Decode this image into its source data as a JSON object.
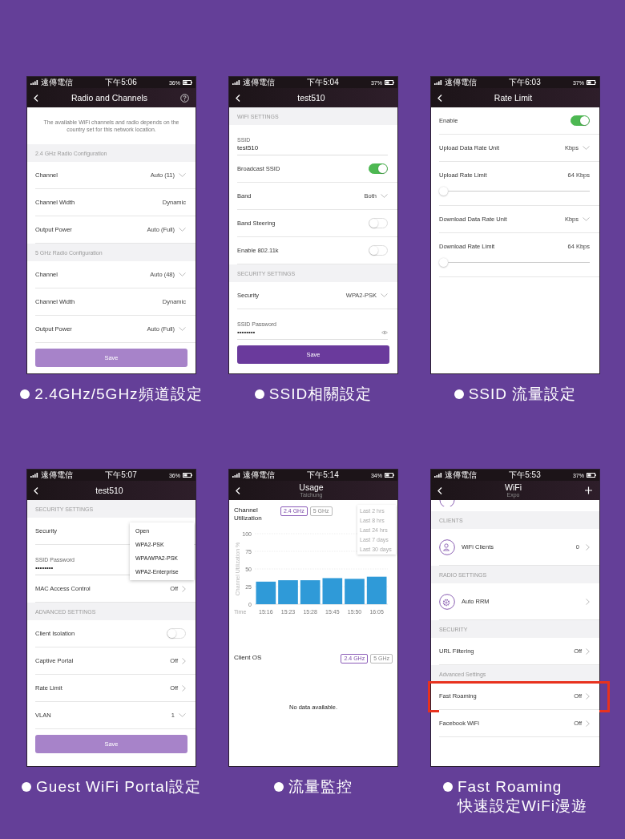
{
  "phones": [
    {
      "status": {
        "carrier": "遠傳電信",
        "time": "下午5:06",
        "battery": "36%"
      },
      "title": "Radio and Channels",
      "help": true,
      "items": [
        {
          "kind": "note",
          "text": "The available WiFi channels and radio depends on the country set for this network location."
        },
        {
          "kind": "section",
          "label": "2.4 GHz Radio Configuration"
        },
        {
          "kind": "select",
          "label": "Channel",
          "value": "Auto (11)"
        },
        {
          "kind": "row",
          "label": "Channel Width",
          "value": "Dynamic"
        },
        {
          "kind": "select",
          "label": "Output Power",
          "value": "Auto (Full)"
        },
        {
          "kind": "section",
          "label": "5 GHz Radio Configuration"
        },
        {
          "kind": "select",
          "label": "Channel",
          "value": "Auto (48)"
        },
        {
          "kind": "row",
          "label": "Channel Width",
          "value": "Dynamic"
        },
        {
          "kind": "select",
          "label": "Output Power",
          "value": "Auto (Full)"
        },
        {
          "kind": "button",
          "label": "Save",
          "disabled": true
        }
      ],
      "caption": [
        "2.4GHz/5GHz頻道設定"
      ]
    },
    {
      "status": {
        "carrier": "遠傳電信",
        "time": "下午5:04",
        "battery": "37%"
      },
      "title": "test510",
      "items": [
        {
          "kind": "section",
          "label": "WIFI SETTINGS"
        },
        {
          "kind": "field",
          "label": "SSID",
          "value": "test510"
        },
        {
          "kind": "toggle",
          "label": "Broadcast SSID",
          "on": true
        },
        {
          "kind": "select",
          "label": "Band",
          "value": "Both"
        },
        {
          "kind": "toggle",
          "label": "Band Steering",
          "on": false
        },
        {
          "kind": "toggle",
          "label": "Enable 802.11k",
          "on": false
        },
        {
          "kind": "section",
          "label": "SECURITY SETTINGS"
        },
        {
          "kind": "select",
          "label": "Security",
          "value": "WPA2-PSK"
        },
        {
          "kind": "field",
          "label": "SSID Password",
          "value": "••••••••",
          "reveal": true
        },
        {
          "kind": "button",
          "label": "Save",
          "disabled": false
        }
      ],
      "caption": [
        "SSID相關設定"
      ]
    },
    {
      "status": {
        "carrier": "遠傳電信",
        "time": "下午6:03",
        "battery": "37%"
      },
      "title": "Rate Limit",
      "items": [
        {
          "kind": "toggle",
          "label": "Enable",
          "on": true
        },
        {
          "kind": "select",
          "label": "Upload Data Rate Unit",
          "value": "Kbps"
        },
        {
          "kind": "slider",
          "label": "Upload Rate Limit",
          "reading": "64 Kbps",
          "level": 0
        },
        {
          "kind": "select",
          "label": "Download Data Rate Unit",
          "value": "Kbps"
        },
        {
          "kind": "slider",
          "label": "Download Rate Limit",
          "reading": "64 Kbps",
          "level": 0
        }
      ],
      "caption": [
        "SSID 流量設定"
      ]
    },
    {
      "status": {
        "carrier": "遠傳電信",
        "time": "下午5:07",
        "battery": "36%"
      },
      "title": "test510",
      "items": [
        {
          "kind": "section",
          "label": "SECURITY SETTINGS"
        },
        {
          "kind": "row",
          "label": "Security"
        },
        {
          "kind": "field",
          "label": "SSID Password",
          "value": "••••••••"
        },
        {
          "kind": "link",
          "label": "MAC Access Control",
          "value": "Off"
        },
        {
          "kind": "section",
          "label": "ADVANCED SETTINGS"
        },
        {
          "kind": "toggle",
          "label": "Client Isolation",
          "on": false
        },
        {
          "kind": "link",
          "label": "Captive Portal",
          "value": "Off"
        },
        {
          "kind": "link",
          "label": "Rate Limit",
          "value": "Off"
        },
        {
          "kind": "select",
          "label": "VLAN",
          "value": "1"
        },
        {
          "kind": "button",
          "label": "Save",
          "disabled": true
        }
      ],
      "dropdown": [
        "Open",
        "WPA2-PSK",
        "WPA/WPA2-PSK",
        "WPA2-Enterprise"
      ],
      "caption": [
        "Guest WiFi Portal設定"
      ]
    },
    {
      "status": {
        "carrier": "遠傳電信",
        "time": "下午5:14",
        "battery": "34%"
      },
      "title": "Usage",
      "subtitle": "Taichung",
      "usage": {
        "chart_title": "Channel Utilization",
        "bands": [
          {
            "label": "2.4 GHz",
            "selected": true
          },
          {
            "label": "5 GHz",
            "selected": false
          }
        ],
        "ranges": [
          "Last 2 hrs",
          "Last 8 hrs",
          "Last 24 hrs",
          "Last 7 days",
          "Last 30 days"
        ],
        "chart_data": {
          "type": "bar",
          "xlabel": "Time",
          "ylabel": "Channel Utilization %",
          "categories": [
            "15:16",
            "15:23",
            "15:28",
            "15:45",
            "15:50",
            "16:05"
          ],
          "values": [
            32,
            34,
            34,
            37,
            36,
            39
          ],
          "ylim": [
            0,
            100
          ],
          "yticks": [
            0,
            25,
            50,
            75,
            100
          ],
          "grid": true
        },
        "os_title": "Client OS",
        "os_bands": [
          {
            "label": "2.4 GHz",
            "selected": true
          },
          {
            "label": "5 GHz",
            "selected": false
          }
        ],
        "empty": "No data available."
      },
      "caption": [
        "流量監控"
      ]
    },
    {
      "status": {
        "carrier": "遠傳電信",
        "time": "下午5:53",
        "battery": "37%"
      },
      "title": "WiFi",
      "subtitle": "Expo",
      "add": true,
      "items": [
        {
          "kind": "cut"
        },
        {
          "kind": "section",
          "label": "CLIENTS"
        },
        {
          "kind": "iconrow",
          "label": "WiFi Clients",
          "value": "0"
        },
        {
          "kind": "section",
          "label": "RADIO SETTINGS"
        },
        {
          "kind": "iconrow",
          "label": "Auto RRM"
        },
        {
          "kind": "section",
          "label": "SECURITY"
        },
        {
          "kind": "link",
          "label": "URL Filtering",
          "value": "Off"
        },
        {
          "kind": "section",
          "label": "Advanced Settings"
        },
        {
          "kind": "link",
          "label": "Fast Roaming",
          "value": "Off",
          "highlight": true
        },
        {
          "kind": "link",
          "label": "Facebook WiFi",
          "value": "Off"
        }
      ],
      "caption": [
        "Fast Roaming",
        "快速設定WiFi漫遊"
      ]
    }
  ]
}
